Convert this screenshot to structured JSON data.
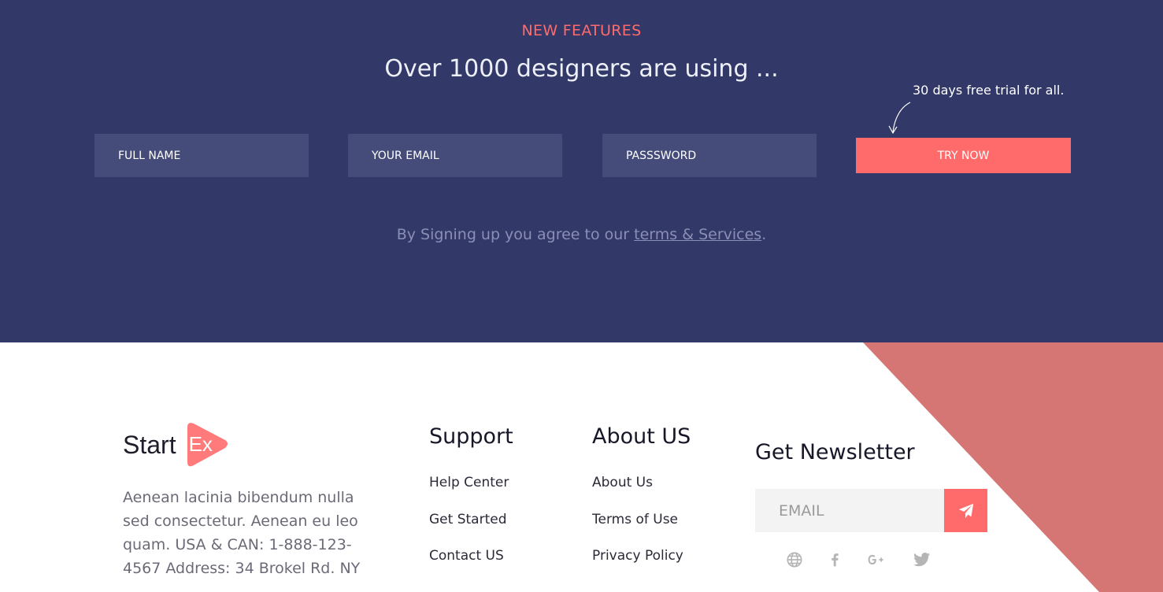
{
  "signup": {
    "kicker": "NEW FEATURES",
    "headline": "Over 1000 designers are using ...",
    "trial_note": "30 days free trial for all.",
    "fields": {
      "full_name_placeholder": "FULL NAME",
      "email_placeholder": "YOUR EMAIL",
      "password_placeholder": "PASSSWORD"
    },
    "try_button": "TRY NOW",
    "agree_prefix": "By Signing up you agree to our ",
    "agree_link": "terms & Services",
    "agree_suffix": "."
  },
  "footer": {
    "brand": {
      "word": "Start",
      "badge": "Ex"
    },
    "about_text": "Aenean lacinia bibendum nulla sed consectetur. Aenean eu leo quam. USA & CAN: 1-888-123-4567 Address: 34 Brokel Rd. NY",
    "columns": [
      {
        "title": "Support",
        "links": [
          "Help Center",
          "Get Started",
          "Contact US"
        ]
      },
      {
        "title": "About US",
        "links": [
          "About Us",
          "Terms of Use",
          "Privacy Policy"
        ]
      }
    ],
    "newsletter": {
      "title": "Get Newsletter",
      "email_placeholder": "EMAIL",
      "send_icon": "paper-plane-icon"
    },
    "social_icons": [
      "globe-icon",
      "facebook-icon",
      "google-plus-icon",
      "twitter-icon"
    ]
  },
  "colors": {
    "signup_bg": "#323867",
    "input_bg": "#464c7a",
    "accent": "#ff6b6b",
    "footer_triangle": "#d67674",
    "muted_text": "#8b8fb6"
  }
}
